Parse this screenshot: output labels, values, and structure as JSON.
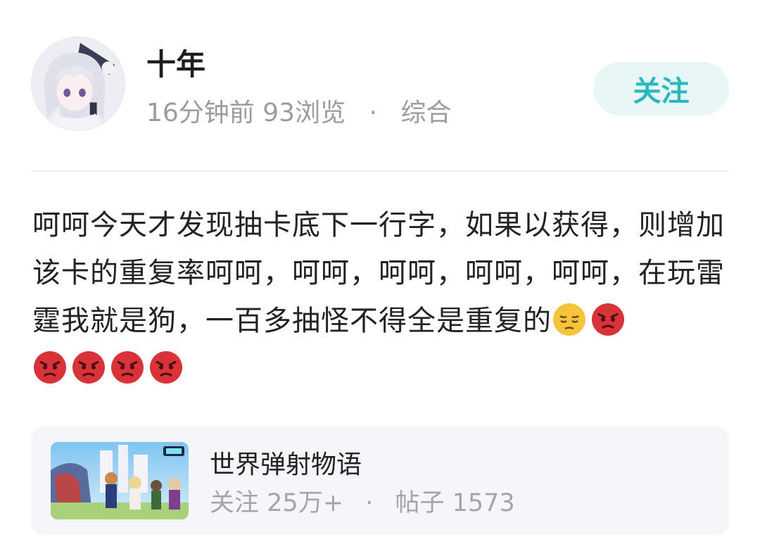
{
  "post": {
    "author": {
      "name": "十年"
    },
    "meta": {
      "time": "16分钟前",
      "views": "93浏览",
      "separator": "·",
      "category": "综合"
    },
    "follow_label": "关注",
    "content": {
      "text": "呵呵今天才发现抽卡底下一行字，如果以获得，则增加该卡的重复率呵呵，呵呵，呵呵，呵呵，呵呵，在玩雷霆我就是狗，一百多抽怪不得全是重复的",
      "emojis": [
        "pensive-face",
        "angry-face",
        "angry-face",
        "angry-face",
        "angry-face",
        "angry-face"
      ]
    }
  },
  "game": {
    "name": "世界弹射物语",
    "followers_label": "关注",
    "followers": "25万+",
    "separator": "·",
    "posts_label": "帖子",
    "posts": "1573"
  },
  "colors": {
    "accent": "#2ab7bd",
    "follow_bg": "#e8f6f6",
    "meta_text": "#9a9ca1",
    "card_bg": "#f5f6f8",
    "angry_red": "#d9333a",
    "pensive_yellow": "#f5c43b"
  }
}
